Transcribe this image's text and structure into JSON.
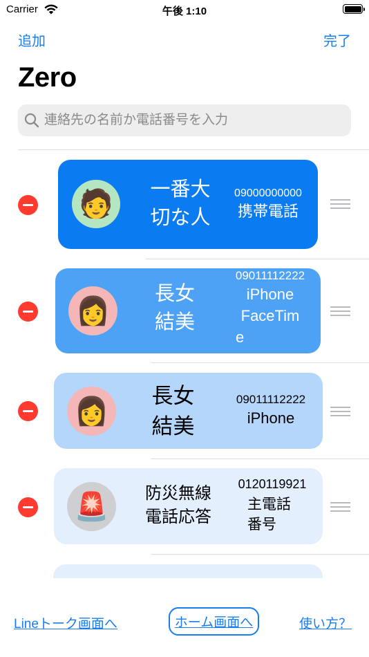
{
  "status_bar": {
    "carrier": "Carrier",
    "time": "午後 1:10"
  },
  "nav": {
    "add_label": "追加",
    "done_label": "完了"
  },
  "title": "Zero",
  "search": {
    "placeholder": "連絡先の名前か電話番号を入力",
    "value": ""
  },
  "contacts": [
    {
      "emoji": "🧑",
      "name_line1": "一番大",
      "name_line2": "切な人",
      "number": "09000000000",
      "label_lines": [
        "携帯電話"
      ],
      "card_color": "#0a7bf0",
      "text_color": "#ffffff",
      "avatar_bg": "#b4e7c1"
    },
    {
      "emoji": "👩",
      "name_line1": "長女",
      "name_line2": "結美",
      "number": "09011112222",
      "label_lines": [
        "iPhone",
        "FaceTim",
        "e"
      ],
      "card_color": "#4ea2f5",
      "text_color": "#ffffff",
      "avatar_bg": "#f5b6b7"
    },
    {
      "emoji": "👩",
      "name_line1": "長女",
      "name_line2": "結美",
      "number": "09011112222",
      "label_lines": [
        "iPhone"
      ],
      "card_color": "#b4d6fb",
      "text_color": "#000000",
      "avatar_bg": "#f5b6b7"
    },
    {
      "emoji": "🚨",
      "name_line1": "防災無線",
      "name_line2": "電話応答",
      "number": "0120119921",
      "label_lines": [
        "主電話",
        "番号"
      ],
      "card_color": "#e3effd",
      "text_color": "#000000",
      "avatar_bg": "#cfcfd2"
    }
  ],
  "bottom": {
    "line_label": "Lineトーク画面へ",
    "home_label": "ホーム画面へ",
    "howto_label": "使い方？"
  },
  "colors": {
    "accent": "#1a7cf0",
    "delete": "#ff3b30"
  }
}
